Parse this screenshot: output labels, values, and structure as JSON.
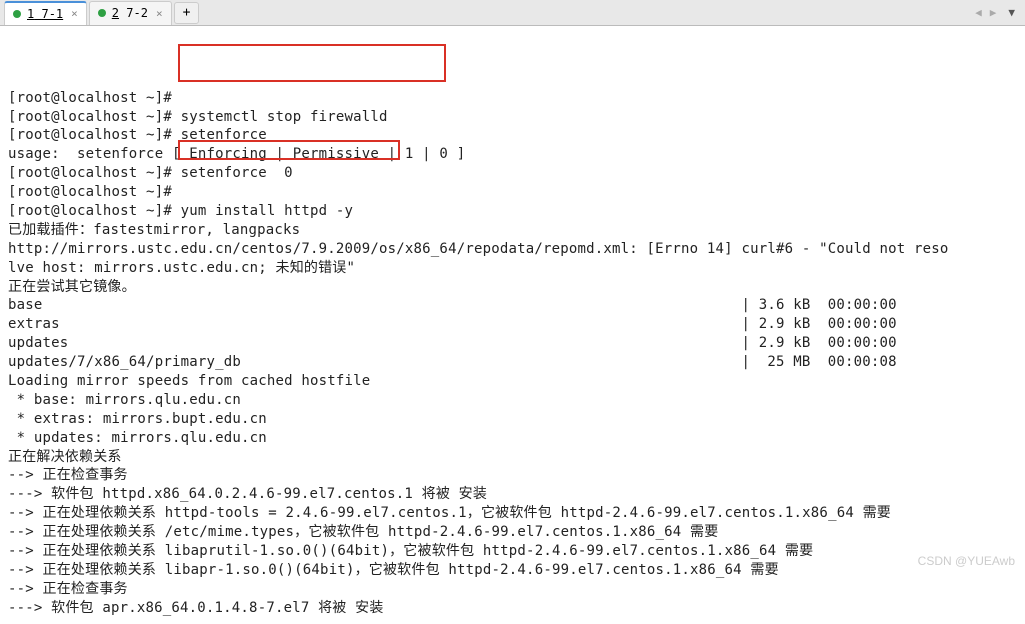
{
  "tabs": {
    "t1": {
      "num": "1",
      "label": "7-1"
    },
    "t2": {
      "num": "2",
      "label": "7-2"
    },
    "close": "×",
    "new": "+"
  },
  "terminal": {
    "l01": "[root@localhost ~]# ",
    "l02": "[root@localhost ~]# systemctl stop firewalld",
    "l03": "[root@localhost ~]# setenforce ",
    "l04": "usage:  setenforce [ Enforcing | Permissive | 1 | 0 ]",
    "l05": "[root@localhost ~]# setenforce  0",
    "l06": "[root@localhost ~]# ",
    "l07": "[root@localhost ~]# yum install httpd -y",
    "l08": "已加载插件：fastestmirror, langpacks",
    "l09": "http://mirrors.ustc.edu.cn/centos/7.9.2009/os/x86_64/repodata/repomd.xml: [Errno 14] curl#6 - \"Could not reso",
    "l10": "lve host: mirrors.ustc.edu.cn; 未知的错误\"",
    "l11": "正在尝试其它镜像。",
    "l12": "base                                                                                 | 3.6 kB  00:00:00",
    "l13": "extras                                                                               | 2.9 kB  00:00:00",
    "l14": "updates                                                                              | 2.9 kB  00:00:00",
    "l15": "updates/7/x86_64/primary_db                                                          |  25 MB  00:00:08",
    "l16": "Loading mirror speeds from cached hostfile",
    "l17": " * base: mirrors.qlu.edu.cn",
    "l18": " * extras: mirrors.bupt.edu.cn",
    "l19": " * updates: mirrors.qlu.edu.cn",
    "l20": "正在解决依赖关系",
    "l21": "--> 正在检查事务",
    "l22": "---> 软件包 httpd.x86_64.0.2.4.6-99.el7.centos.1 将被 安装",
    "l23": "--> 正在处理依赖关系 httpd-tools = 2.4.6-99.el7.centos.1，它被软件包 httpd-2.4.6-99.el7.centos.1.x86_64 需要",
    "l24": "--> 正在处理依赖关系 /etc/mime.types，它被软件包 httpd-2.4.6-99.el7.centos.1.x86_64 需要",
    "l25": "--> 正在处理依赖关系 libaprutil-1.so.0()(64bit)，它被软件包 httpd-2.4.6-99.el7.centos.1.x86_64 需要",
    "l26": "--> 正在处理依赖关系 libapr-1.so.0()(64bit)，它被软件包 httpd-2.4.6-99.el7.centos.1.x86_64 需要",
    "l27": "--> 正在检查事务",
    "l28": "---> 软件包 apr.x86_64.0.1.4.8-7.el7 将被 安装"
  },
  "watermark": "CSDN @YUEAwb"
}
